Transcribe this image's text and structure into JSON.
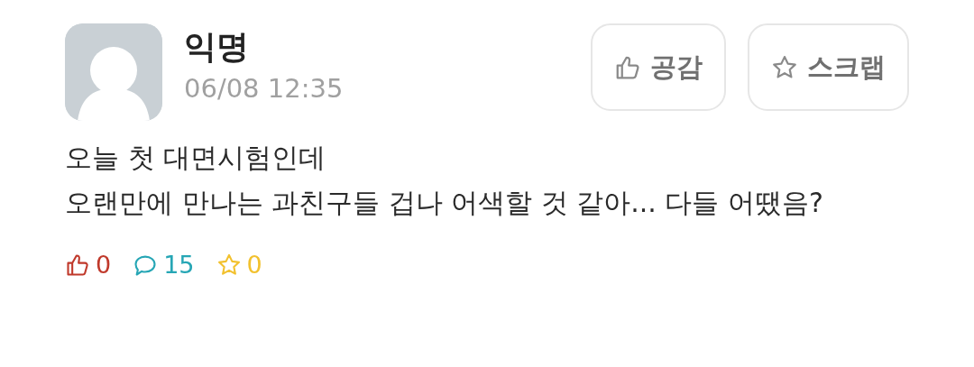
{
  "post": {
    "author": "익명",
    "time": "06/08 12:35",
    "actions": [
      {
        "kind": "like",
        "label": "공감"
      },
      {
        "kind": "scrap",
        "label": "스크랩"
      }
    ],
    "body": [
      "오늘 첫 대면시험인데",
      "오랜만에 만나는 과친구들 겁나 어색할 것 같아... 다들 어땠음?"
    ],
    "stats": [
      {
        "kind": "like",
        "count": "0",
        "color": "#c0392b"
      },
      {
        "kind": "comment",
        "count": "15",
        "color": "#26a6b5"
      },
      {
        "kind": "scrap",
        "count": "0",
        "color": "#f2c12e"
      }
    ]
  }
}
